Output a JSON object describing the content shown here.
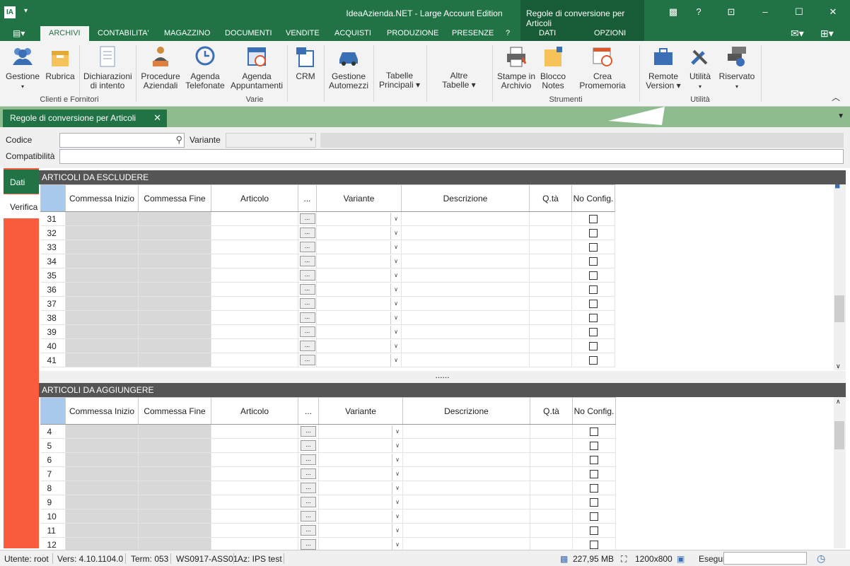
{
  "titlebar": {
    "app_title": "IdeaAzienda.NET - Large Account Edition",
    "context_title": "Regole di conversione per Articoli",
    "help_label": "?"
  },
  "tabs": [
    "ARCHIVI",
    "CONTABILITA'",
    "MAGAZZINO",
    "DOCUMENTI",
    "VENDITE",
    "ACQUISTI",
    "PRODUZIONE",
    "PRESENZE",
    "?"
  ],
  "context_tabs": [
    "DATI",
    "OPZIONI"
  ],
  "ribbon": {
    "buttons": [
      {
        "label1": "Gestione",
        "label2": "▾",
        "icon": "users-icon"
      },
      {
        "label1": "Rubrica",
        "label2": "",
        "icon": "address-book-icon"
      },
      {
        "label1": "Dichiarazioni",
        "label2": "di intento",
        "icon": "document-icon"
      },
      {
        "label1": "Procedure",
        "label2": "Aziendali",
        "icon": "procedure-icon"
      },
      {
        "label1": "Agenda",
        "label2": "Telefonate",
        "icon": "phone-history-icon"
      },
      {
        "label1": "Agenda",
        "label2": "Appuntamenti",
        "icon": "calendar-icon"
      },
      {
        "label1": "CRM",
        "label2": "",
        "icon": "crm-icon"
      },
      {
        "label1": "Gestione",
        "label2": "Automezzi",
        "icon": "car-icon"
      },
      {
        "label1": "Tabelle",
        "label2": "Principali ▾",
        "icon": ""
      },
      {
        "label1": "Altre",
        "label2": "Tabelle ▾",
        "icon": ""
      },
      {
        "label1": "Stampe in",
        "label2": "Archivio",
        "icon": "printer-icon"
      },
      {
        "label1": "Blocco",
        "label2": "Notes",
        "icon": "notes-icon"
      },
      {
        "label1": "Crea Promemoria",
        "label2": "",
        "icon": "reminder-icon"
      },
      {
        "label1": "Remote",
        "label2": "Version ▾",
        "icon": "briefcase-icon"
      },
      {
        "label1": "Utilità",
        "label2": "▾",
        "icon": "tools-icon"
      },
      {
        "label1": "Riservato",
        "label2": "▾",
        "icon": "gear-icon"
      }
    ],
    "groups": [
      "Clienti e Fornitori",
      "Varie",
      "Strumenti",
      "Utilità"
    ]
  },
  "document_tab": {
    "label": "Regole di conversione per Articoli",
    "close": "✕"
  },
  "filters": {
    "codice_label": "Codice",
    "variante_label": "Variante",
    "compatibilita_label": "Compatibilità",
    "codice_value": "",
    "variante_value": ""
  },
  "side_tabs": [
    "Dati",
    "Verifica"
  ],
  "panel_exclude": {
    "title": "ARTICOLI DA ESCLUDERE",
    "columns": [
      "Commessa Inizio",
      "Commessa Fine",
      "Articolo",
      "...",
      "Variante",
      "Descrizione",
      "Q.tà",
      "No Config."
    ],
    "rows": [
      "31",
      "32",
      "33",
      "34",
      "35",
      "36",
      "37",
      "38",
      "39",
      "40",
      "41"
    ]
  },
  "panel_add": {
    "title": "ARTICOLI DA AGGIUNGERE",
    "columns": [
      "Commessa Inizio",
      "Commessa Fine",
      "Articolo",
      "...",
      "Variante",
      "Descrizione",
      "Q.tà",
      "No Config."
    ],
    "rows": [
      "4",
      "5",
      "6",
      "7",
      "8",
      "9",
      "10",
      "11",
      "12"
    ]
  },
  "splitter_label": "......",
  "statusbar": {
    "user": "Utente: root",
    "version": "Vers: 4.10.1104.0",
    "term": "Term: 053",
    "ws": "WS0917-ASS01",
    "az": "Az: IPS test",
    "memory": "227,95 MB",
    "resolution": "1200x800",
    "esegui": "Esegui"
  }
}
